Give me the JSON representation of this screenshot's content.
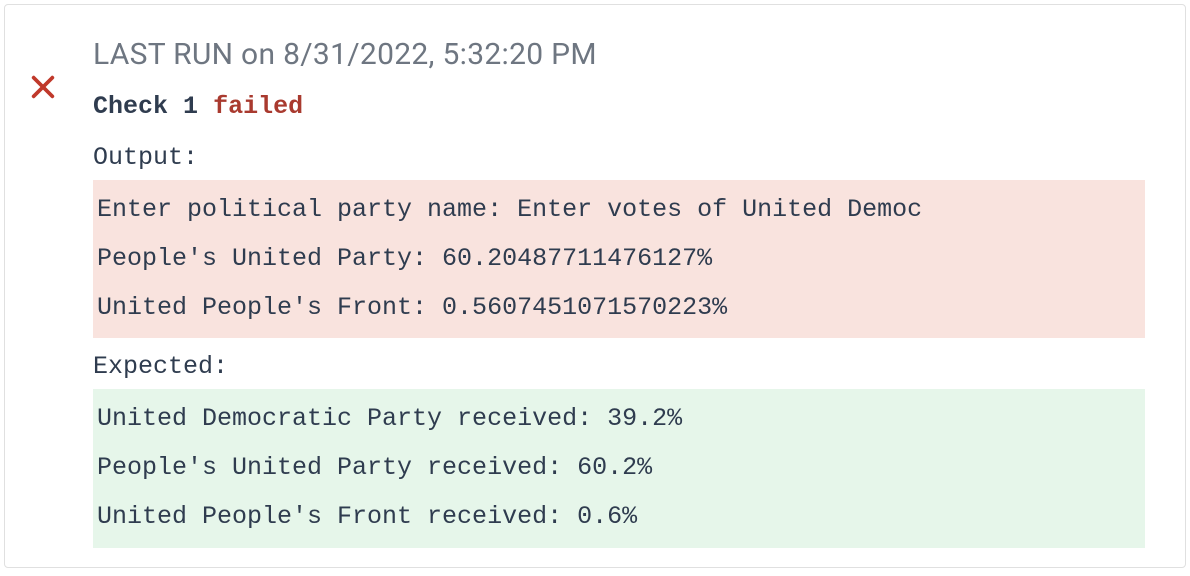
{
  "header": {
    "title": "LAST RUN on 8/31/2022, 5:32:20 PM"
  },
  "check": {
    "prefix": "Check",
    "number": "1",
    "status": "failed"
  },
  "output": {
    "label": "Output:",
    "lines": [
      "Enter political party name: Enter votes of United Democ",
      "People's United Party: 60.20487711476127%",
      "United People's Front: 0.5607451071570223%"
    ]
  },
  "expected": {
    "label": "Expected:",
    "lines": [
      "United Democratic Party received: 39.2%",
      "People's United Party received: 60.2%",
      "United People's Front received: 0.6%"
    ]
  }
}
